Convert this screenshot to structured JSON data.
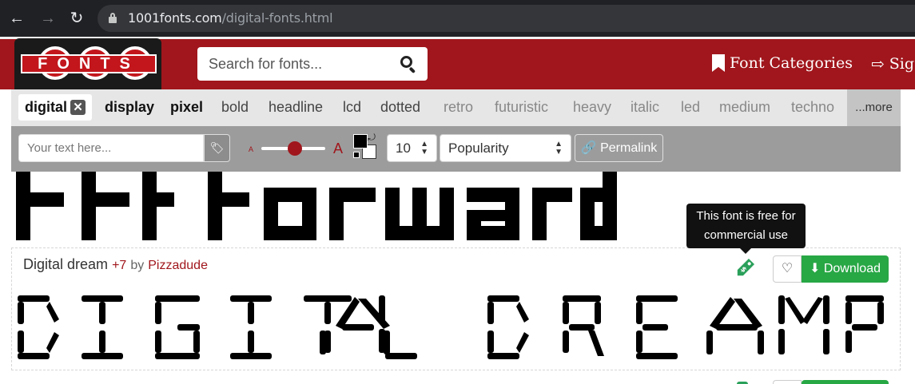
{
  "browser": {
    "url_host": "1001fonts.com",
    "url_path": "/digital-fonts.html",
    "back_icon": "arrow-left",
    "forward_icon": "arrow-right",
    "reload_icon": "reload"
  },
  "header": {
    "logo_text": "FONTS",
    "search_placeholder": "Search for fonts...",
    "nav": [
      {
        "label": "Font Categories",
        "icon": "bookmark-icon"
      },
      {
        "label": "Sig",
        "icon": "sign-in-icon"
      }
    ],
    "brand_color": "#a0161c"
  },
  "tags": {
    "active": {
      "label": "digital",
      "remove": "✕"
    },
    "items": [
      "display",
      "pixel",
      "bold",
      "headline",
      "lcd",
      "dotted",
      "retro",
      "futuristic",
      "heavy",
      "italic",
      "led",
      "medium",
      "techno"
    ],
    "more_label": "...more"
  },
  "toolbar": {
    "text_placeholder": "Your text here...",
    "size_small": "A",
    "size_large": "A",
    "size_value": 0.7,
    "count_value": "10",
    "sort_value": "Popularity",
    "permalink_label": "Permalink"
  },
  "fonts": [
    {
      "preview_text": "FFF Forward"
    },
    {
      "name": "Digital dream",
      "variants": "+7",
      "by": "by",
      "author": "Pizzadude",
      "preview_text": "DIGITAL DREAM R",
      "tooltip": "This font is free for commercial use",
      "download_label": "Download"
    }
  ],
  "colors": {
    "download_green": "#28a745",
    "tag_green": "#2aa05a"
  }
}
